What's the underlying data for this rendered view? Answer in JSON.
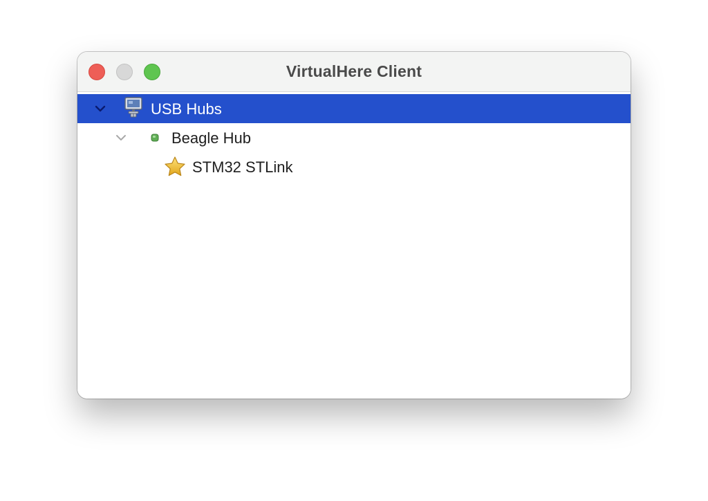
{
  "window": {
    "title": "VirtualHere Client"
  },
  "tree": {
    "items": [
      {
        "label": "USB Hubs",
        "icon": "network-computer-icon",
        "expanded": true,
        "selected": true
      },
      {
        "label": "Beagle Hub",
        "icon": "green-dot-icon",
        "expanded": true,
        "selected": false
      },
      {
        "label": "STM32 STLink",
        "icon": "star-icon",
        "selected": false
      }
    ]
  },
  "colors": {
    "selection": "#2450cc",
    "close": "#ee5e57",
    "minimize": "#d8d8d8",
    "zoom": "#5fc550",
    "status_dot": "#5fae55",
    "star": "#f2c230"
  }
}
